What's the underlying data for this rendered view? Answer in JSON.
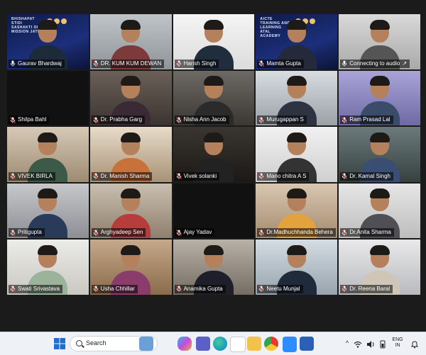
{
  "slides": {
    "left": "BHISHAPAT STIDI SASHAKTI OHA MISSION JATP",
    "right": "AICTE TRAINING AND LEARNING ATAL ACADEMY"
  },
  "participants": [
    {
      "name": "Gaurav Bhardwaj",
      "muted": false,
      "active": true
    },
    {
      "name": "DR. KUM KUM DEWAN",
      "muted": true
    },
    {
      "name": "Harish Singh",
      "muted": true
    },
    {
      "name": "Mamta Gupta",
      "muted": true
    },
    {
      "name": "Connecting to audio",
      "muted": false,
      "connecting": true
    },
    {
      "name": "Shilpa Bahl",
      "muted": true
    },
    {
      "name": "Dr. Prabha Garg",
      "muted": true
    },
    {
      "name": "Nisha Ann Jacob",
      "muted": true
    },
    {
      "name": "Murugappan S",
      "muted": true
    },
    {
      "name": "Ram Prasad Lal",
      "muted": true
    },
    {
      "name": "VIVEK BIRLA",
      "muted": true
    },
    {
      "name": "Dr. Manish Sharma",
      "muted": true
    },
    {
      "name": "Vivek solanki",
      "muted": true
    },
    {
      "name": "Mano chitra A S",
      "muted": true
    },
    {
      "name": "Dr. Kamal Singh",
      "muted": true
    },
    {
      "name": "Pritigupta",
      "muted": true
    },
    {
      "name": "Arghyadeep Sen",
      "muted": true
    },
    {
      "name": "Ajay Yadav",
      "muted": true
    },
    {
      "name": "Dr.Madhuchhanda Behera",
      "muted": true
    },
    {
      "name": "Dr.Anita Sharma",
      "muted": true
    },
    {
      "name": "Swati Srivastava",
      "muted": true
    },
    {
      "name": "Usha Chhillar",
      "muted": true
    },
    {
      "name": "Anamika Gupta",
      "muted": true
    },
    {
      "name": "Neetu Munjal",
      "muted": true
    },
    {
      "name": "Dr. Reena Baral",
      "muted": true
    }
  ],
  "taskbar": {
    "search_label": "Search",
    "language": "ENG",
    "region": "IN",
    "tray_arrow": "^"
  },
  "colors": {
    "active_border": "#3ad56a",
    "muted_icon": "#e0393e",
    "taskbar_bg": "#eef1f6"
  }
}
